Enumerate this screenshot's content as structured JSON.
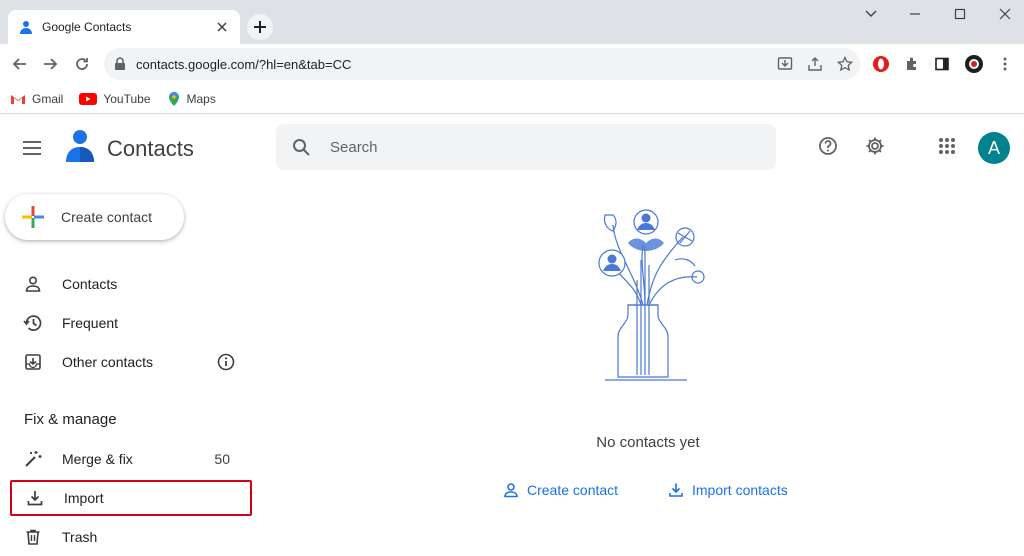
{
  "browser": {
    "tab_title": "Google Contacts",
    "url": "contacts.google.com/?hl=en&tab=CC",
    "bookmarks": [
      {
        "label": "Gmail",
        "icon": "gmail-icon"
      },
      {
        "label": "YouTube",
        "icon": "youtube-icon"
      },
      {
        "label": "Maps",
        "icon": "maps-icon"
      }
    ]
  },
  "header": {
    "app_title": "Contacts",
    "search_placeholder": "Search",
    "avatar_letter": "A"
  },
  "sidebar": {
    "create_label": "Create contact",
    "items": [
      {
        "label": "Contacts",
        "icon": "person-icon"
      },
      {
        "label": "Frequent",
        "icon": "history-icon"
      },
      {
        "label": "Other contacts",
        "icon": "inbox-download-icon"
      }
    ],
    "section_title": "Fix & manage",
    "manage_items": [
      {
        "label": "Merge & fix",
        "icon": "magic-wand-icon",
        "count": "50"
      },
      {
        "label": "Import",
        "icon": "download-icon"
      },
      {
        "label": "Trash",
        "icon": "trash-icon"
      }
    ]
  },
  "main": {
    "empty_text": "No contacts yet",
    "create_link": "Create contact",
    "import_link": "Import contacts"
  },
  "colors": {
    "accent": "#1a73e8",
    "avatar": "#00838f",
    "highlight_box": "#d0021b"
  }
}
